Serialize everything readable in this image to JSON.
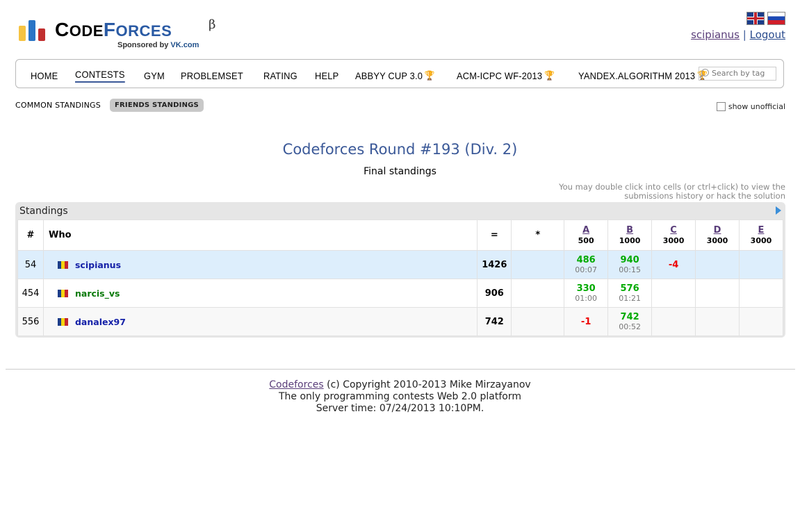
{
  "header": {
    "logo_word_1": "C",
    "logo_word_2": "ODE",
    "logo_word_3": "F",
    "logo_word_4": "ORCES",
    "logo_beta": "β",
    "sponsored_prefix": "Sponsored by",
    "sponsor_name": "VK.com",
    "username": "scipianus",
    "separator": "|",
    "logout": "Logout"
  },
  "menu": {
    "items": [
      {
        "label": "HOME",
        "trophy": false
      },
      {
        "label": "CONTESTS",
        "trophy": false
      },
      {
        "label": "GYM",
        "trophy": false
      },
      {
        "label": "PROBLEMSET",
        "trophy": false
      },
      {
        "label": "RATING",
        "trophy": false
      },
      {
        "label": "HELP",
        "trophy": false
      },
      {
        "label": "ABBYY CUP 3.0",
        "trophy": true
      },
      {
        "label": "ACM-ICPC WF-2013",
        "trophy": true
      },
      {
        "label": "YANDEX.ALGORITHM 2013",
        "trophy": true
      }
    ],
    "active_index": 1,
    "search_placeholder": "Search by tag"
  },
  "subtabs": {
    "common": "COMMON STANDINGS",
    "friends": "FRIENDS STANDINGS",
    "show_unofficial": "show unofficial"
  },
  "contest": {
    "title": "Codeforces Round #193 (Div. 2)",
    "status": "Final standings",
    "hint_line1": "You may double click into cells (or ctrl+click) to view the",
    "hint_line2": "submissions history or hack the solution"
  },
  "standings": {
    "heading": "Standings",
    "columns": {
      "rank": "#",
      "who": "Who",
      "points": "=",
      "penalty": "*"
    },
    "problems": [
      {
        "letter": "A",
        "points": "500"
      },
      {
        "letter": "B",
        "points": "1000"
      },
      {
        "letter": "C",
        "points": "3000"
      },
      {
        "letter": "D",
        "points": "3000"
      },
      {
        "letter": "E",
        "points": "3000"
      }
    ],
    "rows": [
      {
        "rank": "54",
        "handle": "scipianus",
        "score": "1426",
        "penalty": "",
        "a_score": "486",
        "a_time": "00:07",
        "b_score": "940",
        "b_time": "00:15",
        "c_score": "-4"
      },
      {
        "rank": "454",
        "handle": "narcis_vs",
        "score": "906",
        "penalty": "",
        "a_score": "330",
        "a_time": "01:00",
        "b_score": "576",
        "b_time": "01:21",
        "c_score": ""
      },
      {
        "rank": "556",
        "handle": "danalex97",
        "score": "742",
        "penalty": "",
        "a_score": "-1",
        "a_time": "",
        "b_score": "742",
        "b_time": "00:52",
        "c_score": ""
      }
    ]
  },
  "footer": {
    "link": "Codeforces",
    "copyright": "(c) Copyright 2010-2013 Mike Mirzayanov",
    "tagline": "The only programming contests Web 2.0 platform",
    "server_time": "Server time: 07/24/2013 10:10PM."
  },
  "colors": {
    "accent": "#3b5998",
    "accepted": "#00aa00",
    "rejected": "#ee0000",
    "highlight_row": "#ddeefc"
  }
}
